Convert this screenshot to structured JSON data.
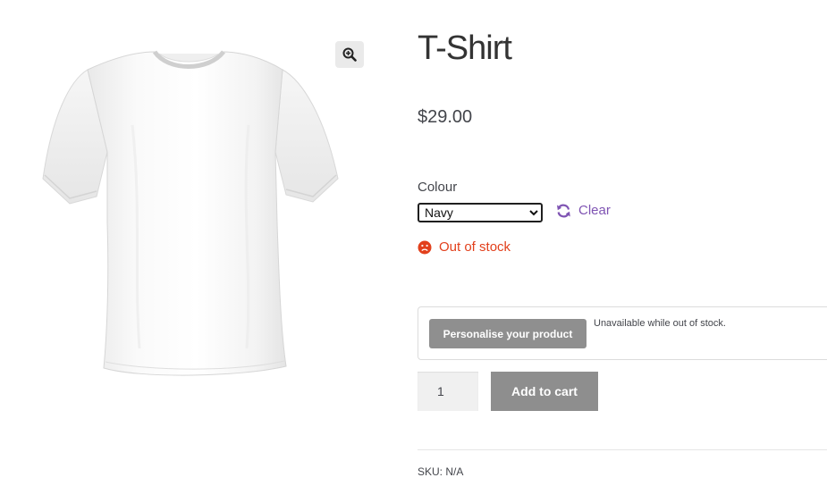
{
  "product": {
    "title": "T-Shirt",
    "price": "$29.00",
    "image_alt": "white-tshirt",
    "zoom_icon": "magnifier-zoom-icon"
  },
  "variation": {
    "label": "Colour",
    "selected": "Navy",
    "clear_label": "Clear",
    "clear_icon": "refresh-icon",
    "clear_color": "#7f54b3"
  },
  "stock": {
    "status": "Out of stock",
    "icon": "sad-face-icon",
    "color": "#e2401c"
  },
  "personalise": {
    "button_label": "Personalise your product",
    "note": "Unavailable while out of stock."
  },
  "cart": {
    "quantity": "1",
    "add_label": "Add to cart"
  },
  "meta": {
    "sku": "SKU: N/A"
  }
}
